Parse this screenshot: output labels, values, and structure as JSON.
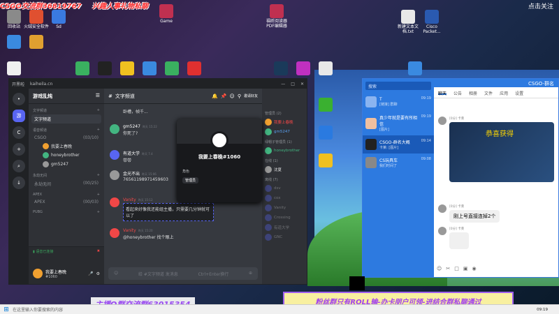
{
  "overlay": {
    "top_left_1": "CSGO交流群36819767",
    "top_left_2": "兴趣人事礼物私聊",
    "top_right": "点击关注"
  },
  "desktop_icons": [
    {
      "label": "回收站",
      "color": "#8a8a8a"
    },
    {
      "label": "火绒安全软件",
      "color": "#e05030"
    },
    {
      "label": "Sd",
      "color": "#3a7ae0"
    },
    {
      "label": "Game",
      "color": "#c03050"
    },
    {
      "label": "福昕阅读器PDF编辑器",
      "color": "#c03050"
    },
    {
      "label": "新建文本文档.txt",
      "color": "#e8e8e8"
    },
    {
      "label": "Cisco Packet...",
      "color": "#2a5ab0"
    }
  ],
  "discord": {
    "titlebar": "开黑啦",
    "titlebar_url": "kaiheila.cn",
    "guilds": [
      "•",
      "游",
      "C",
      "+",
      "⌕",
      "↓"
    ],
    "server_name": "游戏乱炖",
    "categories": [
      {
        "name": "文字频道",
        "channels": [
          {
            "label": "文字频道",
            "active": true
          }
        ]
      },
      {
        "name": "语音频道",
        "channels": [
          {
            "label": "CSGO",
            "count": "(03/10)",
            "members": [
              "我要上春晚",
              "honeybrother",
              "gm5247"
            ]
          }
        ]
      },
      {
        "name": "永劫无间",
        "channels": [
          {
            "label": "永劫无间",
            "count": "(00/25)"
          }
        ]
      },
      {
        "name": "APEX",
        "channels": [
          {
            "label": "APEX",
            "count": "(00/03)"
          }
        ]
      },
      {
        "name": "PUBG",
        "channels": []
      }
    ],
    "voice_status": "语音已连接",
    "user_name": "我要上春晚",
    "user_tag": "#1060",
    "chat_header": "文字频道",
    "invite_label": "邀请好友",
    "messages": [
      {
        "name": "",
        "time": "",
        "text": "卧槽，帧千...",
        "avatar": "#5865f2"
      },
      {
        "name": "gm5247",
        "time": "昨天 15:22",
        "text": "你死了?",
        "avatar": "#43b581"
      },
      {
        "name": "有道大学",
        "time": "昨天 7.4",
        "text": "带带",
        "avatar": "#5865f2"
      },
      {
        "name": "金光不出",
        "time": "昨天 15:06",
        "text": "76561198971459603",
        "avatar": "#999"
      },
      {
        "name": "Vanity",
        "time": "昨天 15:12",
        "text": "看起来好像我还能组主播，只需要几分钟就可以了",
        "avatar": "#f04747"
      },
      {
        "name": "Vanity",
        "time": "昨天 15:20",
        "text": "@honeybrother 找个眼上",
        "avatar": "#f04747"
      }
    ],
    "chat_input_placeholder": "给 #文字频道 发消息",
    "chat_input_hint": "Ctrl+Enter换行",
    "members": {
      "manager_title": "管理员 (2)",
      "managers": [
        "我要上春晚",
        "gm5247"
      ],
      "captain_title": "绿帽子管理员 (1)",
      "captains": [
        "honeybrother"
      ],
      "online_title": "在线 (1)",
      "online": [
        "沈夏"
      ],
      "offline_title": "离线 (7)",
      "offline": [
        "dsv",
        "cox",
        "Vanity",
        "Crossing",
        "有道大学",
        "GNC"
      ]
    },
    "popup": {
      "name": "我要上春晚#1060",
      "role_title": "角色",
      "role": "管理员"
    }
  },
  "qq": {
    "window_title": "CSGO-群名",
    "search_placeholder": "搜索",
    "conversations": [
      {
        "name": "T",
        "sub": "[链接] 群聊",
        "time": "09:19",
        "active": false
      },
      {
        "name": "真少年就是要有所相信",
        "sub": "[图片]",
        "time": "09:19",
        "active": false
      },
      {
        "name": "CSGO-群名大概",
        "sub": "卡莱: [图片]",
        "time": "09:14",
        "active": true
      },
      {
        "name": "CS玩具车",
        "sub": "我们时间了",
        "time": "09:08",
        "active": false
      }
    ],
    "tabs": [
      "聊天",
      "公告",
      "相册",
      "文件",
      "应用",
      "设置"
    ],
    "msg1_meta": "[0分] 卡莱",
    "msg1_image_text": "恭喜获得",
    "msg2_meta": "[0分] 卡莱",
    "msg2_text": "刚上号直接连掉2个",
    "msg3_meta": "[0分] 卡莱"
  },
  "banners": {
    "bottom_left": "主播Q群交流群63015354",
    "bottom_right": "粉丝群只有ROLL输-办卡朋户可领-进结合群私聊通过"
  },
  "taskbar": {
    "search": "在这里输入你要搜索的内容",
    "clock": "09:19"
  }
}
